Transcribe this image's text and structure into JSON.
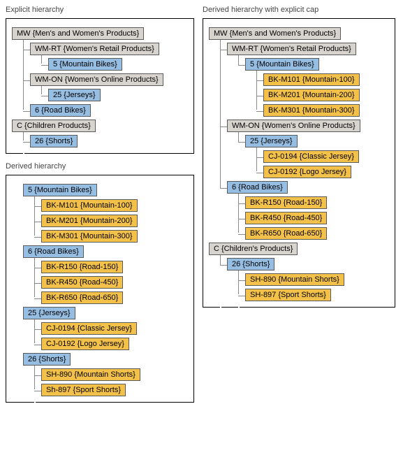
{
  "sections": {
    "explicit": {
      "title": "Explicit hierarchy"
    },
    "derived": {
      "title": "Derived hierarchy"
    },
    "capped": {
      "title": "Derived hierarchy with explicit cap"
    }
  },
  "explicit_tree": {
    "mw": "MW {Men's and Women's Products}",
    "wmrt": "WM-RT {Women's Retail Products}",
    "n5": "5 {Mountain Bikes}",
    "wmon": "WM-ON {Women's Online Products}",
    "n25": "25 {Jerseys}",
    "n6": "6 {Road Bikes}",
    "c": "C {Children Products}",
    "n26": "26 {Shorts}"
  },
  "derived_tree": {
    "n5": "5 {Mountain Bikes}",
    "bkm101": "BK-M101 {Mountain-100}",
    "bkm201": "BK-M201 {Mountain-200}",
    "bkm301": "BK-M301 {Mountain-300}",
    "n6": "6 {Road Bikes}",
    "bkr150": "BK-R150 {Road-150}",
    "bkr450": "BK-R450 {Road-450}",
    "bkr650": "BK-R650 {Road-650}",
    "n25": "25 {Jerseys}",
    "cj0194": "CJ-0194 {Classic Jersey}",
    "cj0192": "CJ-0192 {Logo Jersey}",
    "n26": "26 {Shorts}",
    "sh890": "SH-890 {Mountain Shorts}",
    "sh897": "Sh-897 {Sport Shorts}"
  },
  "capped_tree": {
    "mw": "MW {Men's and Women's Products}",
    "wmrt": "WM-RT {Women's Retail Products}",
    "n5": "5 {Mountain Bikes}",
    "bkm101": "BK-M101 {Mountain-100}",
    "bkm201": "BK-M201 {Mountain-200}",
    "bkm301": "BK-M301 {Mountain-300}",
    "wmon": "WM-ON {Women's Online Products}",
    "n25": "25 {Jerseys}",
    "cj0194": "CJ-0194 {Classic Jersey}",
    "cj0192": "CJ-0192 {Logo Jersey}",
    "n6": "6 {Road Bikes}",
    "bkr150": "BK-R150 {Road-150}",
    "bkr450": "BK-R450 {Road-450}",
    "bkr650": "BK-R650 {Road-650}",
    "c": "C {Children's Products}",
    "n26": "26 {Shorts}",
    "sh890": "SH-890 {Mountain Shorts}",
    "sh897": "SH-897 {Sport Shorts}"
  }
}
